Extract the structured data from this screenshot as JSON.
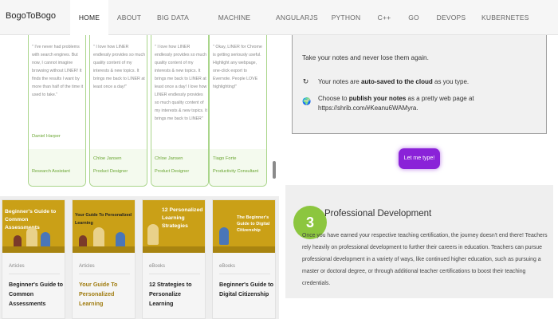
{
  "nav": {
    "brand": "BogoToBogo",
    "items": [
      "HOME",
      "ABOUT",
      "BIG DATA",
      "MACHINE LEARNING",
      "ANGULARJS",
      "PYTHON",
      "C++",
      "GO",
      "DEVOPS",
      "KUBERNETES"
    ],
    "active": "HOME"
  },
  "testimonials": [
    {
      "quote": "\" I've never had problems with search engines. But now, I cannot imagine browsing without LINER! It finds the results I want by more than half of the time it used to take.\"",
      "name": "Daniel Harper",
      "role": "Research Assistant"
    },
    {
      "quote": "\" I love how LINER endlessly provides so much quality content of my interests & new topics. It brings me back to LINER at least once a day!\"",
      "name": "Chloe Jansen",
      "role": "Product Designer"
    },
    {
      "quote": "\" I love how LINER endlessly provides so much quality content of my interests & new topics. It brings me back to LINER at least once a day! I love how LINER endlessly provides so much quality content of my interests & new topics. It brings me back to LINER\"",
      "name": "Chloe Jansen",
      "role": "Product Designer"
    },
    {
      "quote": "\" Okay, LINER for Chrome is getting seriously useful. Highlight any webpage, one-click export to Evernote. People LOVE highlighting!\"",
      "name": "Tiago Forte",
      "role": "Productivity Consultant"
    }
  ],
  "articles": [
    {
      "thumb_title": "Beginner's Guide to Common Assessments",
      "category": "Articles",
      "title": "Beginner's Guide to Common Assessments",
      "highlight": false
    },
    {
      "thumb_title": "Your Guide To Personalized Learning",
      "category": "Articles",
      "title": "Your Guide To Personalized Learning",
      "highlight": true
    },
    {
      "thumb_title": "12 Personalized Learning Strategies",
      "category": "eBooks",
      "title": "12 Strategies to Personalize Learning",
      "highlight": false
    },
    {
      "thumb_title": "The Beginner's Guide to Digital Citizenship",
      "category": "eBooks",
      "title": "Beginner's Guide to Digital Citizenship",
      "highlight": false
    }
  ],
  "notes": {
    "head": "Take your notes and never lose them again.",
    "line1_pre": "Your notes are ",
    "line1_bold": "auto-saved to the cloud",
    "line1_post": " as you type.",
    "line2_pre": "Choose to ",
    "line2_bold": "publish your notes",
    "line2_post": " as a pretty web page at https://shrib.com/#Keanu6WAMyra.",
    "sync_icon": "sync-icon",
    "globe_icon": "globe-icon"
  },
  "cta": {
    "label": "Let me type!"
  },
  "professional": {
    "step": "3",
    "title": "Professional Development",
    "body": "Once you have earned your respective teaching certification, the journey doesn't end there! Teachers rely heavily on professional development to further their careers in education. Teachers can pursue professional development in a variety of ways, like continued higher education, such as pursuing a master or doctoral degree, or through additional teacher certifications to boost their teaching credentials."
  },
  "colors": {
    "accent_green": "#8cc63f",
    "cta_purple": "#8a22d8",
    "card_gold": "#caa017"
  }
}
